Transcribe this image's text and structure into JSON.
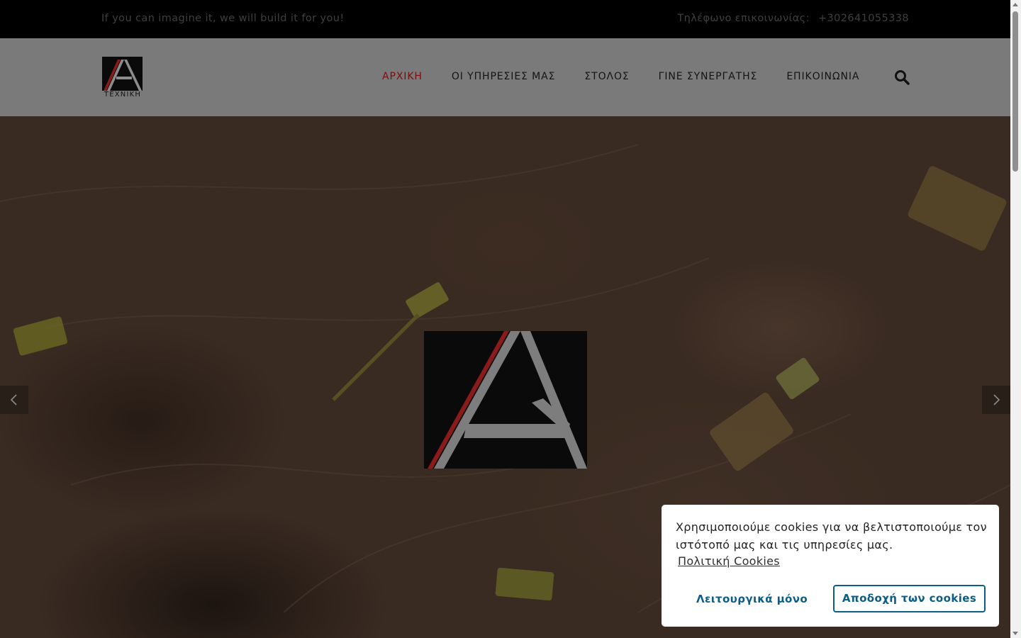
{
  "topbar": {
    "tagline": "If you can imagine it, we will build it for you!",
    "phone_label": "Τηλέφωνο επικοινωνίας:",
    "phone_number": "+302641055338"
  },
  "header": {
    "logo_word": "ΤΕΧΝΙΚΗ",
    "nav": [
      {
        "label": "ΑΡΧΙΚΗ",
        "active": true
      },
      {
        "label": "ΟΙ ΥΠΗΡΕΣΙΕΣ ΜΑΣ",
        "active": false
      },
      {
        "label": "ΣΤΟΛΟΣ",
        "active": false
      },
      {
        "label": "ΓΙΝΕ ΣΥΝΕΡΓΑΤΗΣ",
        "active": false
      },
      {
        "label": "ΕΠΙΚΟΙΝΩΝΙΑ",
        "active": false
      }
    ],
    "search_icon": "search-icon"
  },
  "hero": {
    "prev_icon": "chevron-left-icon",
    "next_icon": "chevron-right-icon"
  },
  "cookie": {
    "message": "Χρησιμοποιούμε cookies για να βελτιστοποιούμε τον ιστότοπό μας και τις υπηρεσίες μας.",
    "policy_link": "Πολιτική Cookies",
    "functional_only": "Λειτουργικά μόνο",
    "accept": "Αποδοχή των cookies"
  },
  "colors": {
    "topbar_bg": "#000000",
    "header_bg": "#7a7a7a",
    "active_nav": "#7a0e0e",
    "cookie_button": "#0b5d85",
    "logo_red": "#8b1a1a",
    "logo_gray": "#8c8c8c"
  }
}
